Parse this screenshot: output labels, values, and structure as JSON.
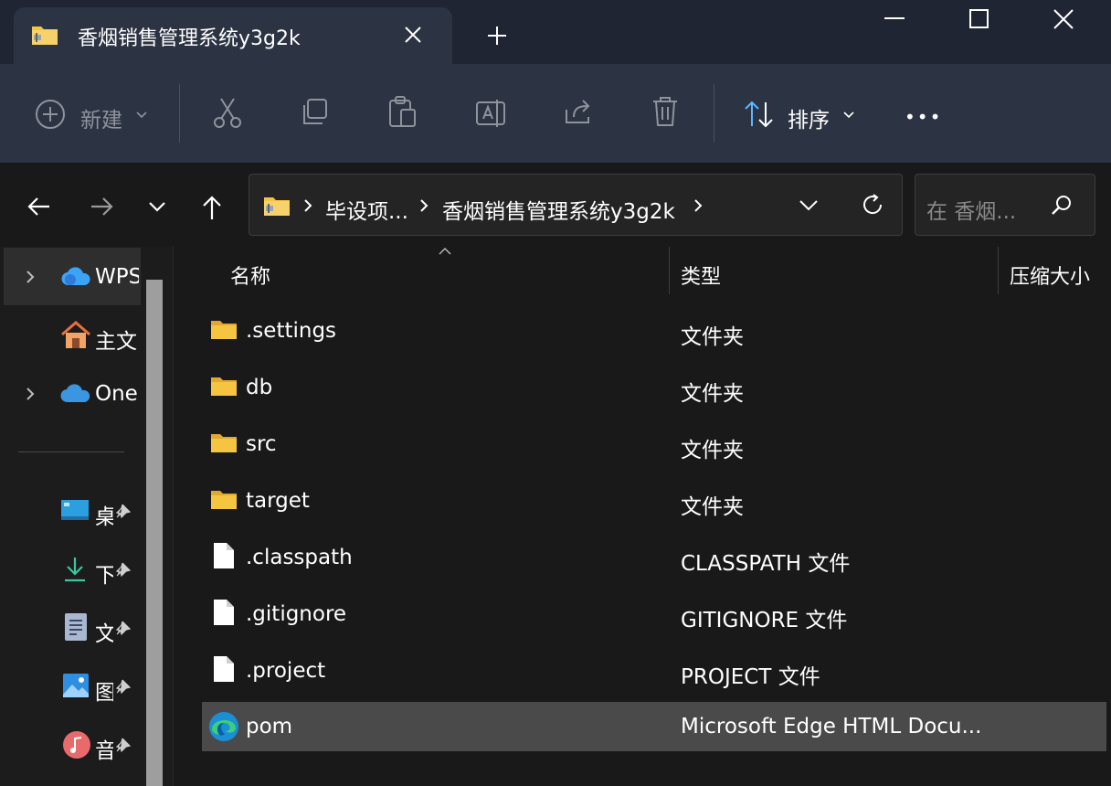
{
  "window": {
    "tab_title": "香烟销售管理系统y3g2k",
    "new_tab_label": "+"
  },
  "toolbar": {
    "new_label": "新建",
    "sort_label": "排序",
    "more_label": "•••"
  },
  "address": {
    "crumbs": [
      "毕设项...",
      "香烟销售管理系统y3g2k"
    ],
    "search_placeholder": "在 香烟..."
  },
  "sidebar": {
    "items": [
      {
        "label": "WPS",
        "icon": "wps-cloud-icon"
      },
      {
        "label": "主文",
        "icon": "home-icon"
      },
      {
        "label": "One",
        "icon": "onedrive-icon"
      }
    ],
    "pinned": [
      {
        "label": "桌",
        "icon": "desktop-icon"
      },
      {
        "label": "下",
        "icon": "download-icon"
      },
      {
        "label": "文",
        "icon": "documents-icon"
      },
      {
        "label": "图",
        "icon": "pictures-icon"
      },
      {
        "label": "音",
        "icon": "music-icon"
      }
    ]
  },
  "columns": {
    "name": "名称",
    "type": "类型",
    "size": "压缩大小"
  },
  "files": [
    {
      "name": ".settings",
      "type": "文件夹",
      "icon": "folder-icon"
    },
    {
      "name": "db",
      "type": "文件夹",
      "icon": "folder-icon"
    },
    {
      "name": "src",
      "type": "文件夹",
      "icon": "folder-icon"
    },
    {
      "name": "target",
      "type": "文件夹",
      "icon": "folder-icon"
    },
    {
      "name": ".classpath",
      "type": "CLASSPATH 文件",
      "icon": "file-icon"
    },
    {
      "name": ".gitignore",
      "type": "GITIGNORE 文件",
      "icon": "file-icon"
    },
    {
      "name": ".project",
      "type": "PROJECT 文件",
      "icon": "file-icon"
    },
    {
      "name": "pom",
      "type": "Microsoft Edge HTML Docu...",
      "icon": "edge-icon"
    }
  ],
  "colors": {
    "titlebar": "#1f2532",
    "toolbar": "#2c3342",
    "folder": "#f5c542",
    "selected_row": "#4a4a4a"
  }
}
